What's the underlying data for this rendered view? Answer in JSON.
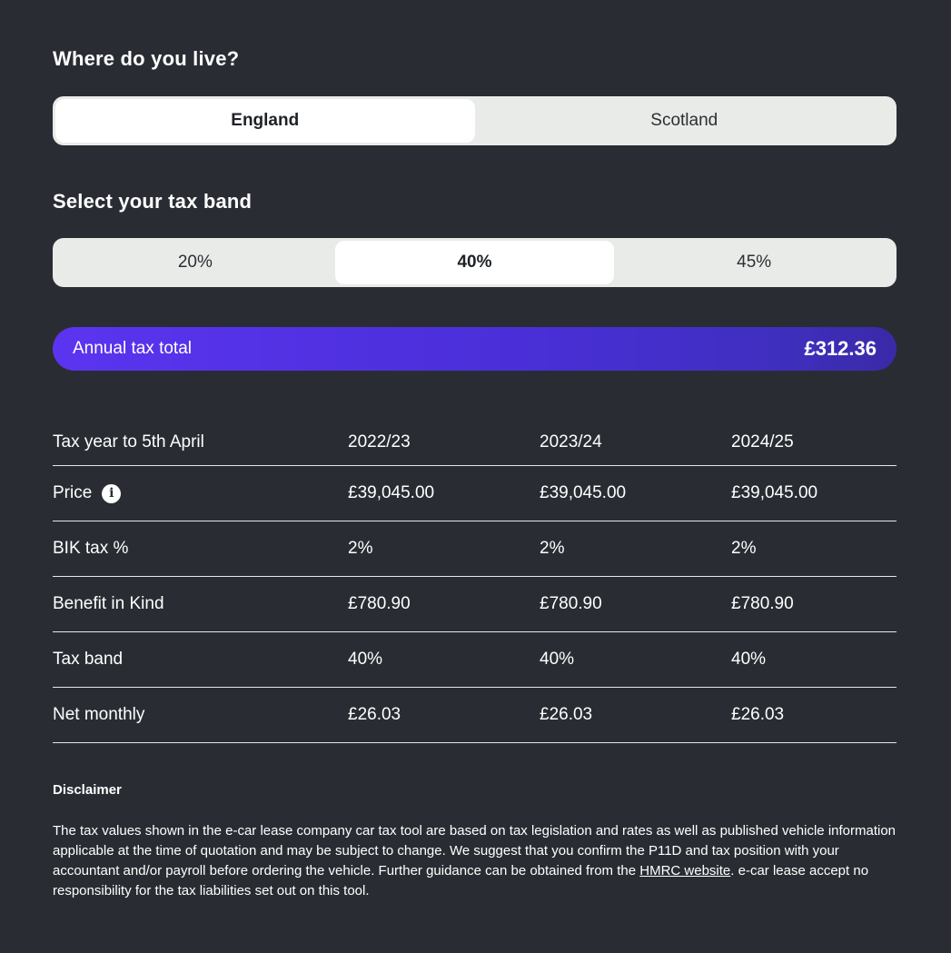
{
  "location": {
    "heading": "Where do you live?",
    "options": [
      "England",
      "Scotland"
    ],
    "selected": "England"
  },
  "tax_band": {
    "heading": "Select your tax band",
    "options": [
      "20%",
      "40%",
      "45%"
    ],
    "selected": "40%"
  },
  "annual_total": {
    "label": "Annual tax total",
    "value": "£312.36"
  },
  "table": {
    "header": [
      "Tax year to 5th April",
      "2022/23",
      "2023/24",
      "2024/25"
    ],
    "rows": [
      {
        "label": "Price",
        "info_icon": "info-icon",
        "values": [
          "£39,045.00",
          "£39,045.00",
          "£39,045.00"
        ]
      },
      {
        "label": "BIK tax %",
        "values": [
          "2%",
          "2%",
          "2%"
        ]
      },
      {
        "label": "Benefit in Kind",
        "values": [
          "£780.90",
          "£780.90",
          "£780.90"
        ]
      },
      {
        "label": "Tax band",
        "values": [
          "40%",
          "40%",
          "40%"
        ]
      },
      {
        "label": "Net monthly",
        "values": [
          "£26.03",
          "£26.03",
          "£26.03"
        ]
      }
    ]
  },
  "disclaimer": {
    "title": "Disclaimer",
    "text_before_link": "The tax values shown in the e-car lease company car tax tool are based on tax legislation and rates as well as published vehicle information applicable at the time of quotation and may be subject to change. We suggest that you confirm the P11D and tax position with your accountant and/or payroll before ordering the vehicle. Further guidance can be obtained from the ",
    "link_text": "HMRC website",
    "text_after_link": ". e-car lease accept no responsibility for the tax liabilities set out on this tool."
  },
  "colors": {
    "background": "#292d33",
    "segment_bg": "#e8ebe8",
    "accent_start": "#5b34f0",
    "accent_end": "#3a2aa8"
  }
}
